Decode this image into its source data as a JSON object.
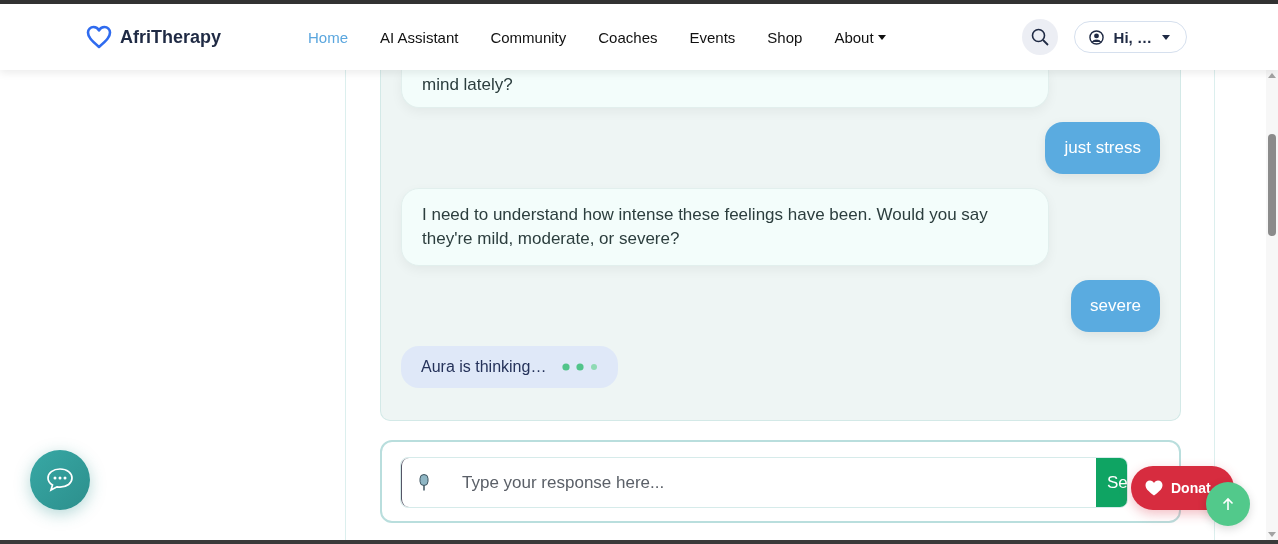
{
  "brand": {
    "name": "AfriTherapy"
  },
  "nav": [
    {
      "label": "Home",
      "selected": true,
      "dropdown": false
    },
    {
      "label": "AI Assistant",
      "selected": false,
      "dropdown": false
    },
    {
      "label": "Community",
      "selected": false,
      "dropdown": false
    },
    {
      "label": "Coaches",
      "selected": false,
      "dropdown": false
    },
    {
      "label": "Events",
      "selected": false,
      "dropdown": false
    },
    {
      "label": "Shop",
      "selected": false,
      "dropdown": false
    },
    {
      "label": "About",
      "selected": false,
      "dropdown": true
    }
  ],
  "user_menu": {
    "label": "Hi, …"
  },
  "messages": [
    {
      "kind": "bot",
      "text": "mind lately?"
    },
    {
      "kind": "user",
      "text": "just stress"
    },
    {
      "kind": "bot",
      "text": "I need to understand how intense these feelings have been. Would you say they're mild, moderate, or severe?"
    },
    {
      "kind": "user",
      "text": "severe"
    }
  ],
  "typing": {
    "text": "Aura is thinking…"
  },
  "input": {
    "placeholder": "Type your response here...",
    "send_label": "Se"
  },
  "donate": {
    "label": "Donat"
  }
}
